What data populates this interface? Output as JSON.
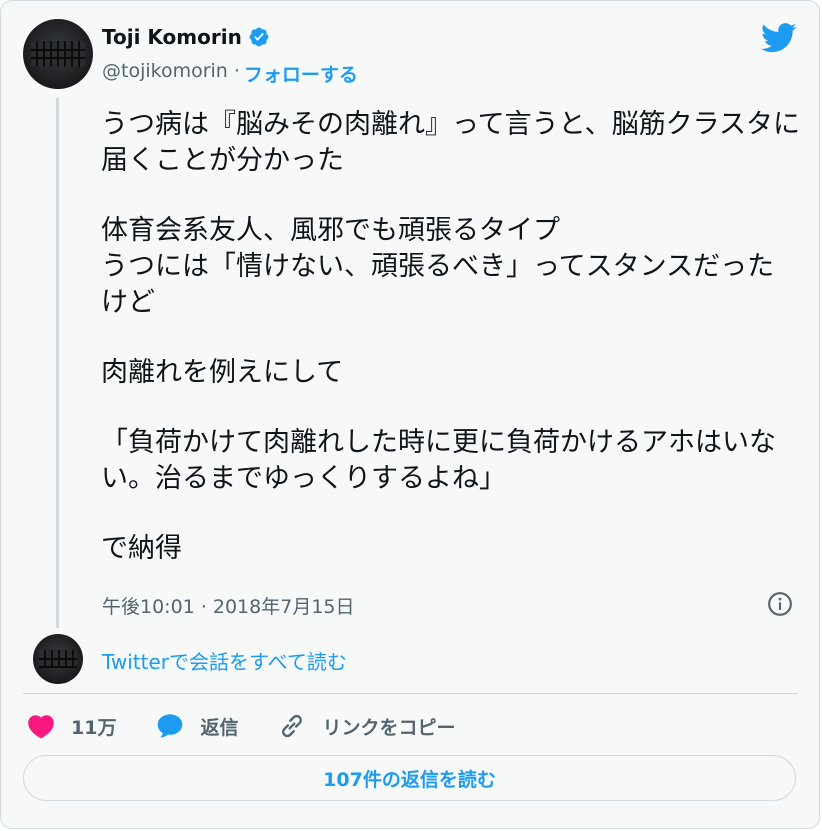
{
  "user": {
    "name": "Toji Komorin",
    "handle": "@tojikomorin",
    "separator": "·",
    "follow_label": "フォローする"
  },
  "tweet": {
    "paragraphs": [
      "うつ病は『脳みその肉離れ』って言うと、脳筋クラスタに届くことが分かった",
      "体育会系友人、風邪でも頑張るタイプ\nうつには「情けない、頑張るべき」ってスタンスだったけど",
      "肉離れを例えにして",
      "「負荷かけて肉離れした時に更に負荷かけるアホはいない。治るまでゆっくりするよね」",
      "で納得"
    ],
    "timestamp": "午後10:01 · 2018年7月15日"
  },
  "conversation_link": "Twitterで会話をすべて読む",
  "actions": {
    "like_count": "11万",
    "reply_label": "返信",
    "copy_link_label": "リンクをコピー"
  },
  "read_replies_label": "107件の返信を読む",
  "colors": {
    "accent": "#1d9bf0",
    "like": "#f91880",
    "text": "#0f1419",
    "muted": "#536471",
    "background": "#f7f9f9"
  },
  "icons": [
    "verified-badge-icon",
    "twitter-bird-icon",
    "info-icon",
    "heart-icon",
    "reply-bubble-icon",
    "link-icon"
  ]
}
